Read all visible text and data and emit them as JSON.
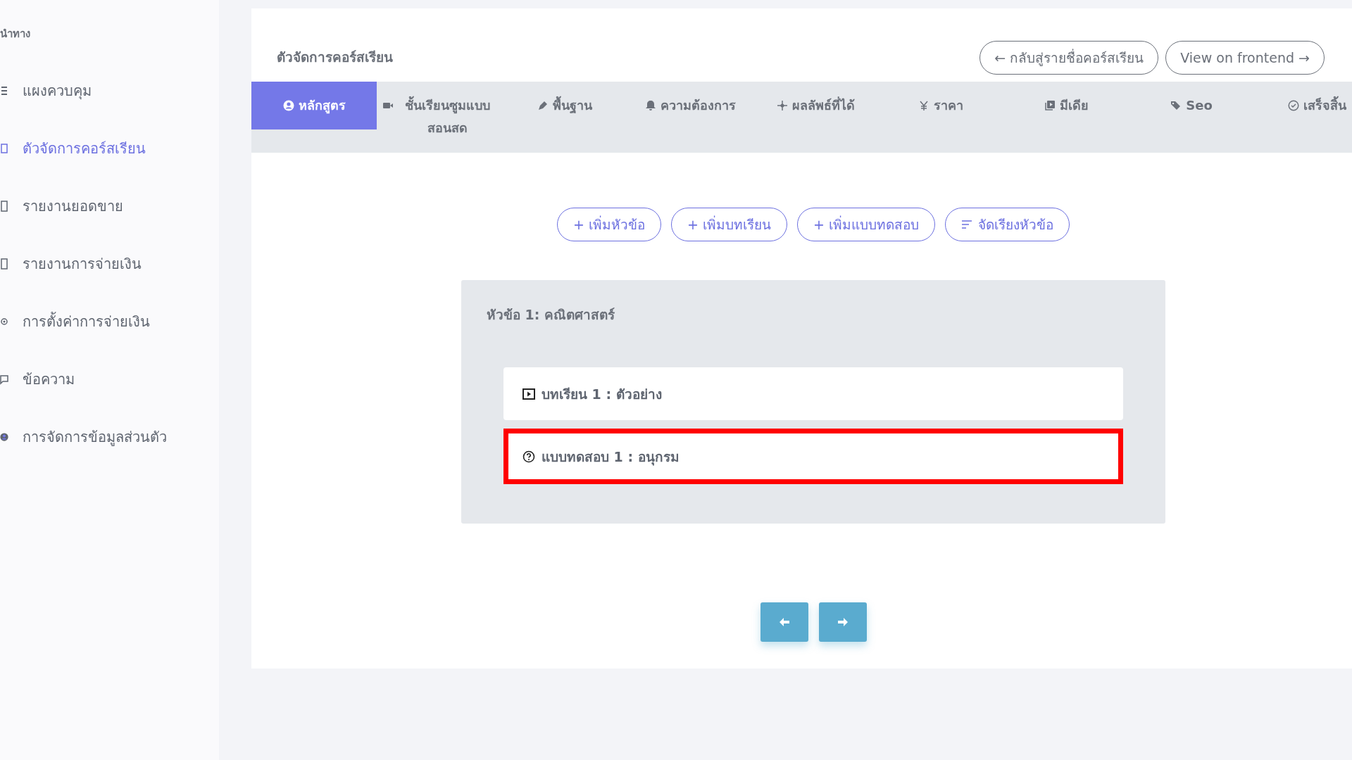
{
  "sidebar": {
    "heading": "นำทาง",
    "items": [
      {
        "label": "แผงควบคุม",
        "selected": false
      },
      {
        "label": "ตัวจัดการคอร์สเรียน",
        "selected": true
      },
      {
        "label": "รายงานยอดขาย",
        "selected": false
      },
      {
        "label": "รายงานการจ่ายเงิน",
        "selected": false
      },
      {
        "label": "การตั้งค่าการจ่ายเงิน",
        "selected": false
      },
      {
        "label": "ข้อความ",
        "selected": false
      },
      {
        "label": "การจัดการข้อมูลส่วนตัว",
        "selected": false
      }
    ]
  },
  "card": {
    "title": "ตัวจัดการคอร์สเรียน",
    "header_buttons": [
      "← กลับสู่รายชื่อคอร์สเรียน",
      "View on frontend →"
    ],
    "tabs": [
      {
        "label": "หลักสูตร",
        "selected": true
      },
      {
        "label": "ชั้นเรียนซูมแบบสอนสด",
        "selected": false
      },
      {
        "label": "พื้นฐาน",
        "selected": false
      },
      {
        "label": "ความต้องการ",
        "selected": false
      },
      {
        "label": "ผลลัพธ์ที่ได้",
        "selected": false
      },
      {
        "label": "ราคา",
        "selected": false
      },
      {
        "label": "มีเดีย",
        "selected": false
      },
      {
        "label": "Seo",
        "selected": false
      },
      {
        "label": "เสร็จสิ้น",
        "selected": false
      }
    ],
    "actions": [
      "+ เพิ่มหัวข้อ",
      "+ เพิ่มบทเรียน",
      "+ เพิ่มแบบทดสอบ",
      "จัดเรียงหัวข้อ"
    ],
    "section": {
      "title": "หัวข้อ 1: คณิตศาสตร์",
      "items": [
        {
          "kind": "lesson",
          "label": "บทเรียน 1 : ตัวอย่าง",
          "highlighted": false
        },
        {
          "kind": "quiz",
          "label": "แบบทดสอบ 1 : อนุกรม",
          "highlighted": true
        }
      ]
    }
  }
}
